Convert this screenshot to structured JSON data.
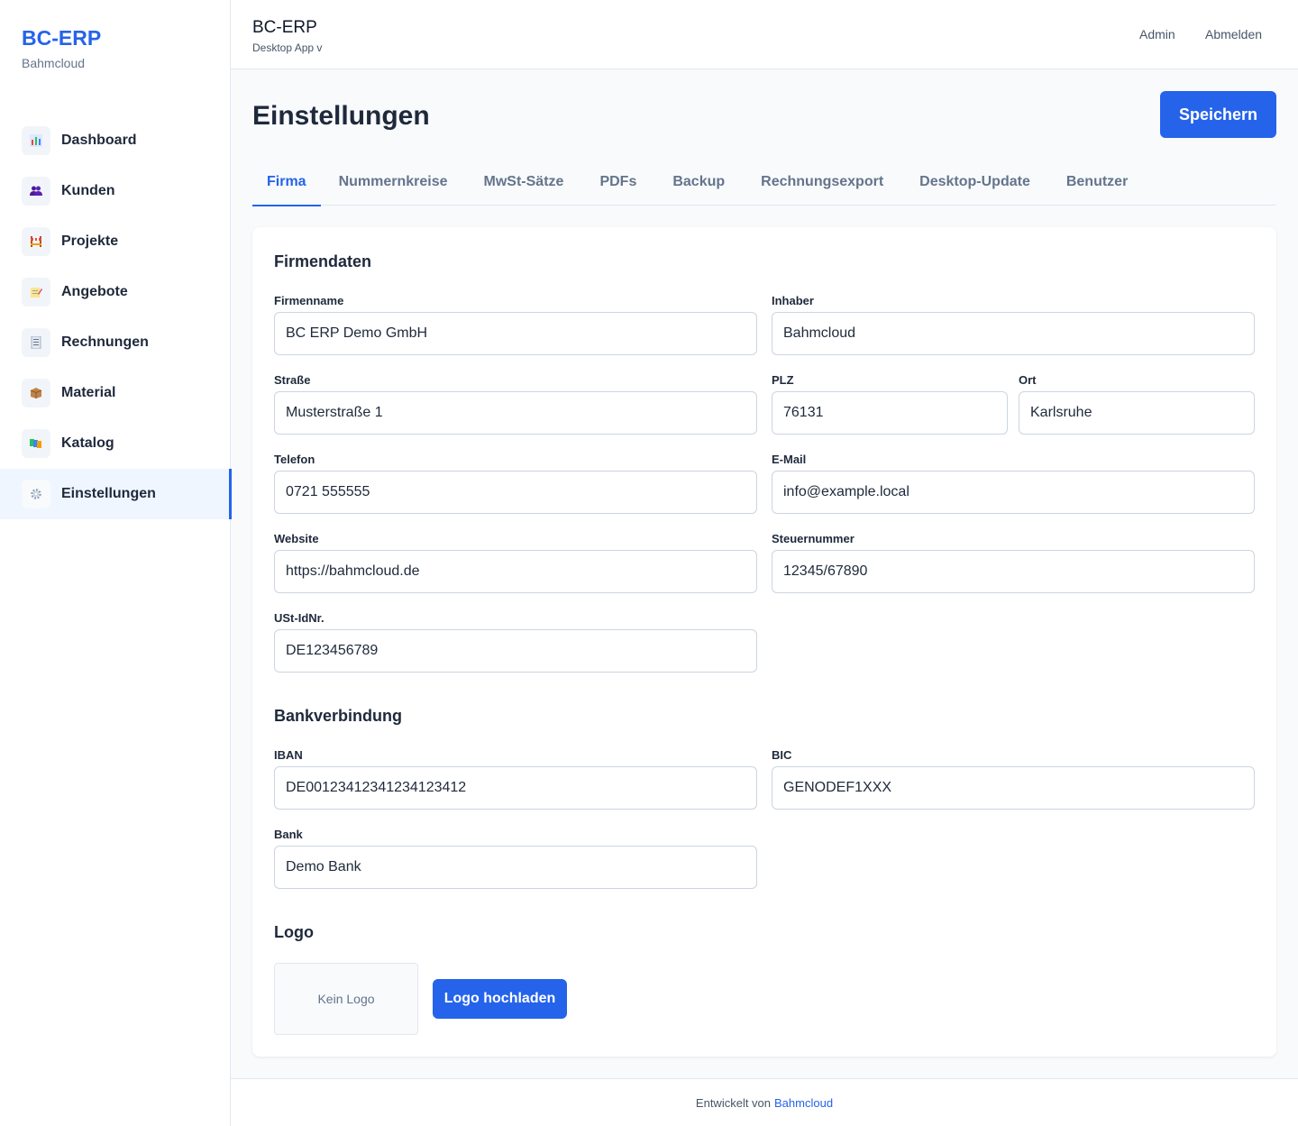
{
  "sidebar": {
    "brand_title": "BC-ERP",
    "brand_sub": "Bahmcloud",
    "items": [
      {
        "label": "Dashboard",
        "icon": "bar-chart-icon"
      },
      {
        "label": "Kunden",
        "icon": "people-icon"
      },
      {
        "label": "Projekte",
        "icon": "construction-icon"
      },
      {
        "label": "Angebote",
        "icon": "memo-icon"
      },
      {
        "label": "Rechnungen",
        "icon": "receipt-icon"
      },
      {
        "label": "Material",
        "icon": "package-icon"
      },
      {
        "label": "Katalog",
        "icon": "books-icon"
      },
      {
        "label": "Einstellungen",
        "icon": "gear-icon",
        "active": true
      }
    ]
  },
  "topbar": {
    "title": "BC-ERP",
    "subtitle": "Desktop App v",
    "admin_label": "Admin",
    "logout_label": "Abmelden"
  },
  "page": {
    "title": "Einstellungen",
    "save_label": "Speichern"
  },
  "tabs": [
    "Firma",
    "Nummernkreise",
    "MwSt-Sätze",
    "PDFs",
    "Backup",
    "Rechnungsexport",
    "Desktop-Update",
    "Benutzer"
  ],
  "active_tab": "Firma",
  "firmendaten": {
    "title": "Firmendaten",
    "firmenname": {
      "label": "Firmenname",
      "value": "BC ERP Demo GmbH"
    },
    "inhaber": {
      "label": "Inhaber",
      "value": "Bahmcloud"
    },
    "strasse": {
      "label": "Straße",
      "value": "Musterstraße 1"
    },
    "plz": {
      "label": "PLZ",
      "value": "76131"
    },
    "ort": {
      "label": "Ort",
      "value": "Karlsruhe"
    },
    "telefon": {
      "label": "Telefon",
      "value": "0721 555555"
    },
    "email": {
      "label": "E-Mail",
      "value": "info@example.local"
    },
    "website": {
      "label": "Website",
      "value": "https://bahmcloud.de"
    },
    "steuernummer": {
      "label": "Steuernummer",
      "value": "12345/67890"
    },
    "ustid": {
      "label": "USt-IdNr.",
      "value": "DE123456789"
    }
  },
  "bank": {
    "title": "Bankverbindung",
    "iban": {
      "label": "IBAN",
      "value": "DE00123412341234123412"
    },
    "bic": {
      "label": "BIC",
      "value": "GENODEF1XXX"
    },
    "bank": {
      "label": "Bank",
      "value": "Demo Bank"
    }
  },
  "logo": {
    "title": "Logo",
    "placeholder": "Kein Logo",
    "upload_label": "Logo hochladen"
  },
  "footer": {
    "text": "Entwickelt von",
    "link": "Bahmcloud"
  },
  "colors": {
    "accent": "#2563eb",
    "text": "#1e293b",
    "muted": "#64748b",
    "border": "#e2e8f0",
    "background": "#f8fafc"
  }
}
